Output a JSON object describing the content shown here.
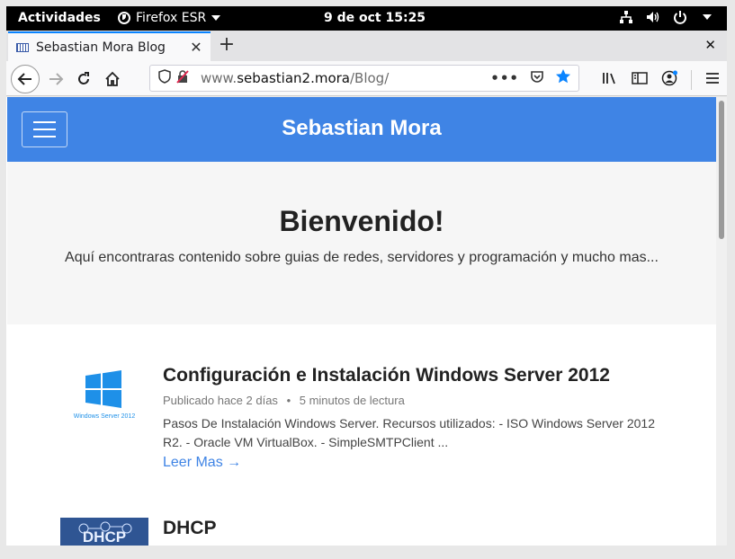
{
  "topbar": {
    "activities": "Actividades",
    "app_name": "Firefox ESR",
    "clock": "9 de oct  15:25",
    "icons": [
      "network-icon",
      "volume-icon",
      "power-icon",
      "chevron-down-icon"
    ]
  },
  "browser": {
    "tab_title": "Sebastian Mora Blog",
    "url_prefix": "www.",
    "url_domain": "sebastian2.mora",
    "url_path": "/Blog/",
    "accent": "#0a84ff"
  },
  "site": {
    "brand": "Sebastian Mora",
    "nav_color": "#3f84e5",
    "hero_title": "Bienvenido!",
    "hero_text": "Aquí encontraras contenido sobre guias de redes, servidores y programación y mucho mas..."
  },
  "posts": [
    {
      "title": "Configuración e Instalación Windows Server 2012",
      "meta_date": "Publicado hace 2 días",
      "meta_sep": "•",
      "meta_read": "5 minutos de lectura",
      "excerpt": "Pasos De Instalación Windows Server. Recursos utilizados: - ISO Windows Server 2012 R2. - Oracle VM VirtualBox. - SimpleSMTPClient ...",
      "read_more": "Leer Mas →",
      "thumb_label": "Windows Server 2012"
    },
    {
      "title": "DHCP",
      "thumb_label": "DHCP"
    }
  ]
}
